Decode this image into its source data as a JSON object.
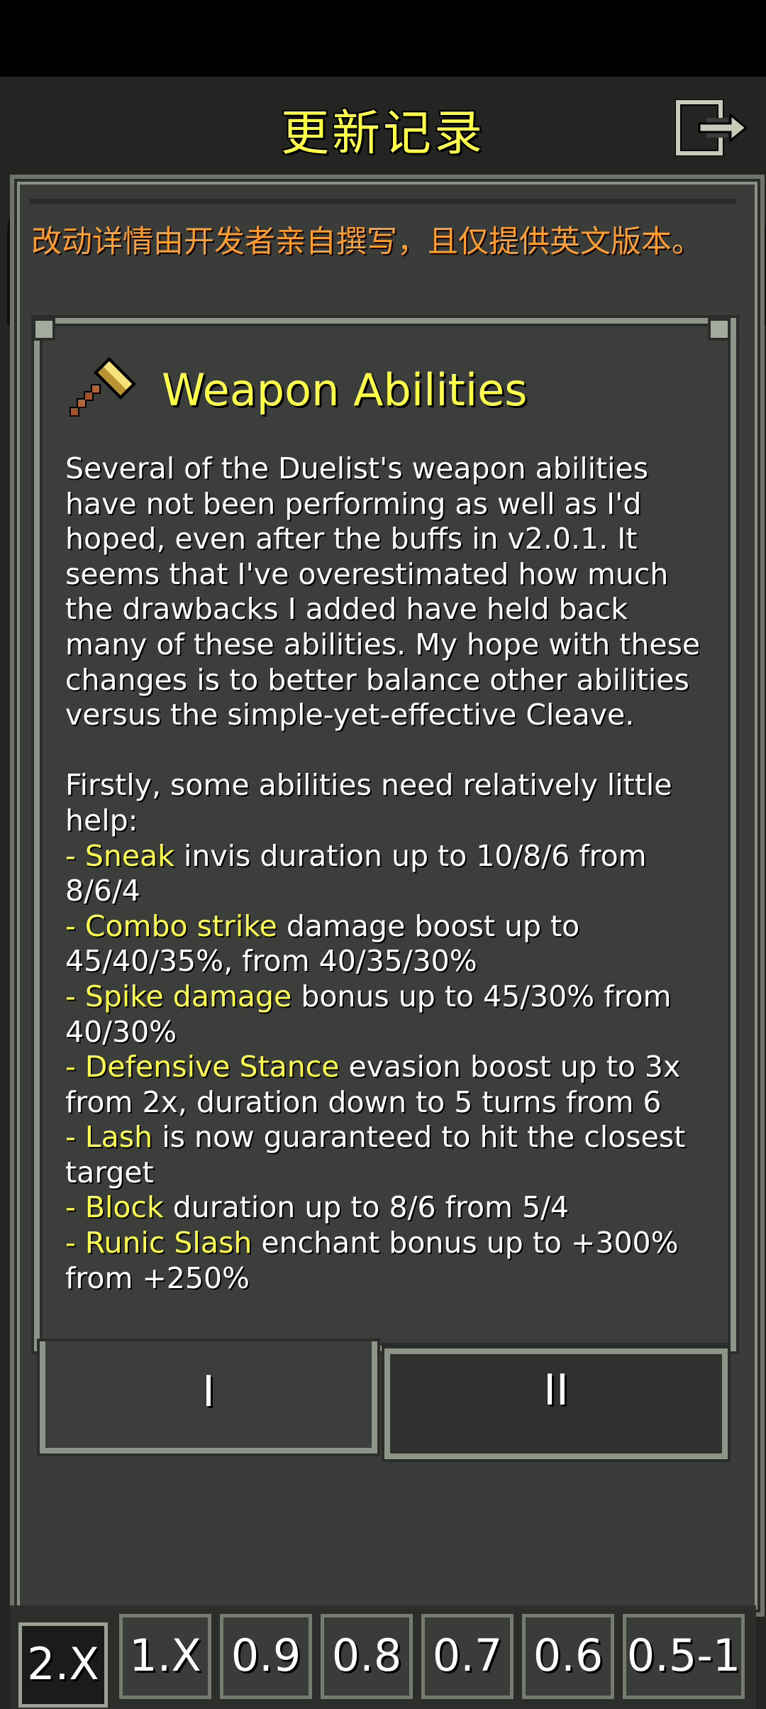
{
  "header": {
    "title": "更新记录"
  },
  "notice": "改动详情由开发者亲自撰写，且仅提供英文版本。",
  "entry": {
    "icon": "golden-hammer-icon",
    "title": "Weapon Abilities",
    "paragraph1": "Several of the Duelist's weapon abilities have not been performing as well as I'd hoped, even after the buffs in v2.0.1. It seems that I've overestimated how much the drawbacks I added have held back many of these abilities. My hope with these changes is to better balance other abilities versus the simple-yet-effective Cleave.",
    "paragraph2": "Firstly, some abilities need relatively little help:",
    "changes": [
      {
        "prefix": "- ",
        "name": "Sneak",
        "text": " invis duration up to 10/8/6 from 8/6/4"
      },
      {
        "prefix": "- ",
        "name": "Combo strike",
        "text": " damage boost up to 45/40/35%, from 40/35/30%"
      },
      {
        "prefix": "- ",
        "name": "Spike damage",
        "text": " bonus up to 45/30% from 40/30%"
      },
      {
        "prefix": "- ",
        "name": "Defensive Stance",
        "text": " evasion boost up to 3x from 2x, duration down to 5 turns from 6"
      },
      {
        "prefix": "- ",
        "name": "Lash",
        "text": " is now guaranteed to hit the closest target"
      },
      {
        "prefix": "- ",
        "name": "Block",
        "text": " duration up to 8/6 from 5/4"
      },
      {
        "prefix": "- ",
        "name": "Runic Slash",
        "text": " enchant bonus up to +300% from +250%"
      }
    ]
  },
  "tabs": [
    {
      "label": "I",
      "selected": true
    },
    {
      "label": "II",
      "selected": false
    }
  ],
  "speeds": {
    "selected": "2.X",
    "options": [
      "2.X",
      "1.X",
      "0.9",
      "0.8",
      "0.7",
      "0.6",
      "0.5-1"
    ]
  },
  "colors": {
    "highlight": "#ffff44",
    "notice": "#ff9c2a",
    "panel": "#3c3e3b",
    "border": "#8e9488"
  }
}
